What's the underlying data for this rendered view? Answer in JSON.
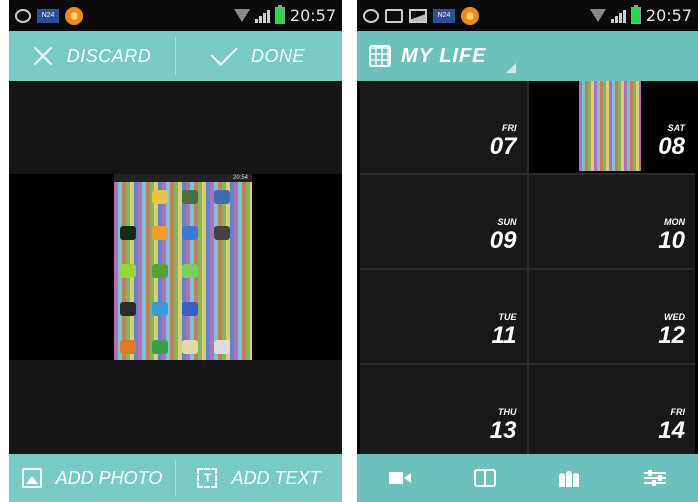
{
  "left": {
    "status_time": "20:57",
    "status_news_label": "N24",
    "discard_label": "DISCARD",
    "done_label": "DONE",
    "add_photo_label": "ADD PHOTO",
    "add_text_label": "ADD TEXT",
    "embedded_time": "20:54",
    "accent": "#77cbc3"
  },
  "right": {
    "status_time": "20:57",
    "status_news_label": "N24",
    "title": "MY LIFE",
    "accent": "#6cc2ba",
    "days": [
      {
        "dow": "FRI",
        "day": "07"
      },
      {
        "dow": "SAT",
        "day": "08"
      },
      {
        "dow": "SUN",
        "day": "09"
      },
      {
        "dow": "MON",
        "day": "10"
      },
      {
        "dow": "TUE",
        "day": "11"
      },
      {
        "dow": "WED",
        "day": "12"
      },
      {
        "dow": "THU",
        "day": "13"
      },
      {
        "dow": "FRI",
        "day": "14"
      }
    ],
    "nav_icons": [
      "video-icon",
      "book-icon",
      "people-icon",
      "settings-sliders-icon"
    ]
  }
}
